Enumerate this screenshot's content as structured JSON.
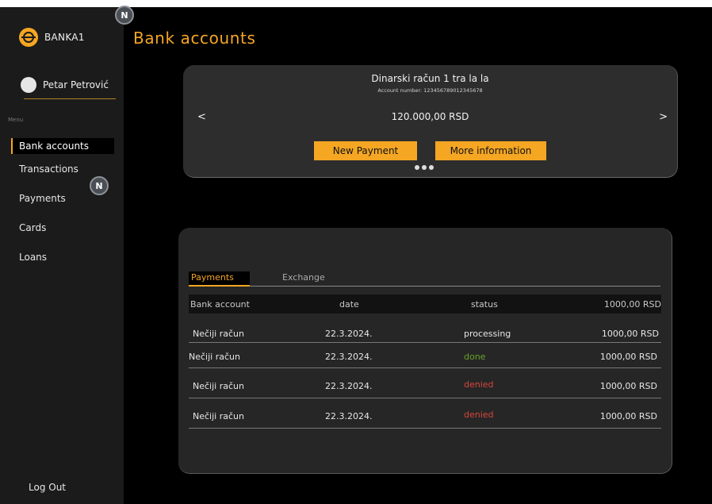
{
  "app": {
    "name": "BANKA1"
  },
  "user": {
    "name": "Petar Petrović"
  },
  "sidebar": {
    "menu_label": "Menu",
    "items": [
      {
        "label": "Bank accounts",
        "active": true
      },
      {
        "label": "Transactions"
      },
      {
        "label": "Payments"
      },
      {
        "label": "Cards"
      },
      {
        "label": "Loans"
      }
    ],
    "logout": "Log Out"
  },
  "page": {
    "title": "Bank accounts"
  },
  "account": {
    "name": "Dinarski račun 1 tra la la",
    "number_text": "Account number: 123456789012345678",
    "balance": "120.000,00 RSD",
    "prev": "<",
    "next": ">",
    "new_payment_label": "New Payment",
    "more_info_label": "More information",
    "carousel_dots": 3
  },
  "table": {
    "tabs": [
      {
        "label": "Payments",
        "active": true
      },
      {
        "label": "Exchange"
      }
    ],
    "columns": [
      "Bank account",
      "date",
      "status",
      "1000,00 RSD"
    ],
    "rows": [
      {
        "account": "Nečiji račun",
        "date": "22.3.2024.",
        "status": "processing",
        "amount": "1000,00 RSD"
      },
      {
        "account": "Nečiji račun",
        "date": "22.3.2024.",
        "status": "done",
        "amount": "1000,00 RSD"
      },
      {
        "account": "Nečiji račun",
        "date": "22.3.2024.",
        "status": "denied",
        "amount": "1000,00 RSD"
      },
      {
        "account": "Nečiji račun",
        "date": "22.3.2024.",
        "status": "denied",
        "amount": "1000,00 RSD"
      }
    ]
  },
  "badges": {
    "letter": "N"
  },
  "colors": {
    "accent": "#f5a623",
    "done": "#6aa12b",
    "denied": "#d9463b",
    "background": "#000000",
    "sidebar": "#1b1b1b"
  }
}
